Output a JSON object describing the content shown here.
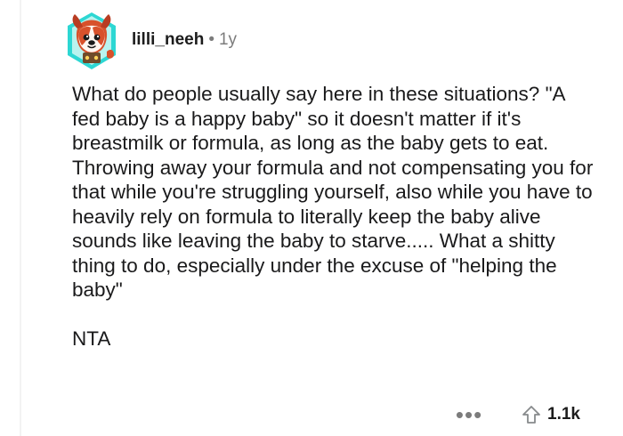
{
  "comment": {
    "author": "lilli_neeh",
    "separator": "•",
    "age": "1y",
    "paragraphs": [
      "What do people usually say here in these situations? \"A fed baby is a happy baby\" so it doesn't matter if it's breastmilk or formula, as long as the baby gets to eat. Throwing away your formula and not compensating you for that while you're struggling yourself, also while you have to heavily rely on formula to literally keep the baby alive sounds like leaving the baby to starve..... What a shitty thing to do, especially under the excuse of \"helping the baby\"",
      "NTA"
    ],
    "more_options": "•••",
    "score": "1.1k"
  },
  "icons": {
    "avatar": "snoo-dog-avatar",
    "more": "more-options-icon",
    "upvote": "upvote-arrow-icon"
  },
  "colors": {
    "text": "#1a1a1b",
    "meta": "#7c7c7c",
    "avatar_bg": "#2dd7d3",
    "avatar_orange": "#d8512b"
  }
}
